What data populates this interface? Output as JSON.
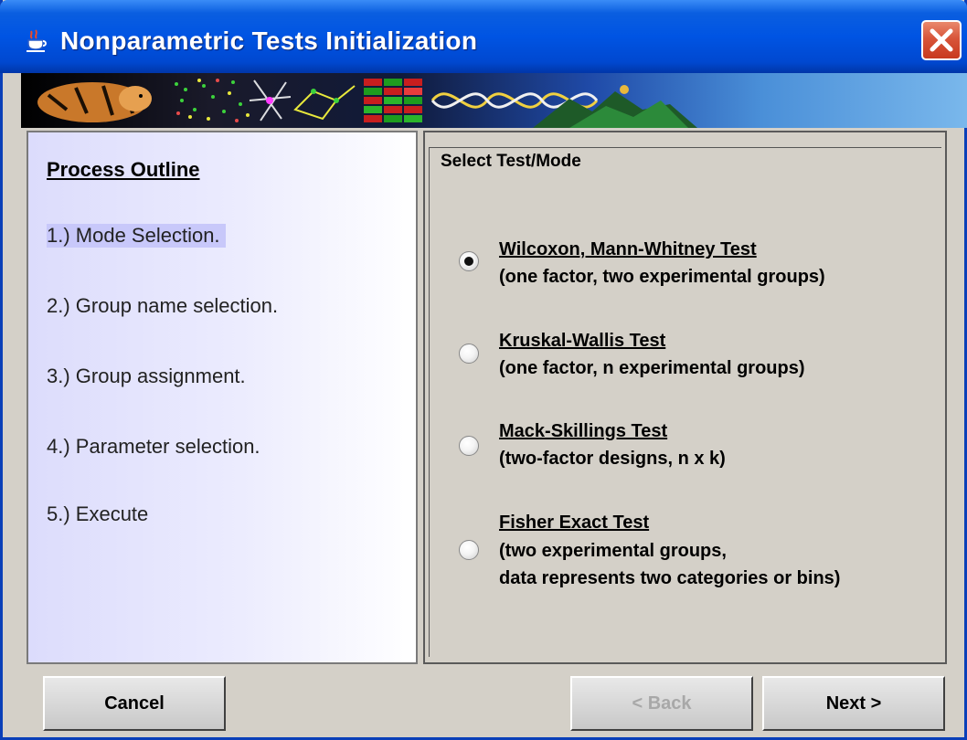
{
  "window": {
    "title": "Nonparametric Tests Initialization"
  },
  "outline": {
    "heading": "Process Outline",
    "steps": [
      "1.) Mode Selection.",
      "2.) Group name selection.",
      "3.) Group assignment.",
      "4.) Parameter selection.",
      "5.) Execute"
    ],
    "active_step": 0
  },
  "test_panel": {
    "label": "Select Test/Mode",
    "options": [
      {
        "title": "Wilcoxon, Mann-Whitney Test",
        "desc": [
          "(one factor, two experimental groups)"
        ],
        "selected": true
      },
      {
        "title": "Kruskal-Wallis Test",
        "desc": [
          "(one factor, n experimental groups)"
        ],
        "selected": false
      },
      {
        "title": "Mack-Skillings Test",
        "desc": [
          "(two-factor designs, n x k)"
        ],
        "selected": false
      },
      {
        "title": "Fisher Exact Test",
        "desc": [
          "(two experimental groups,",
          "data represents two categories or bins)"
        ],
        "selected": false
      }
    ]
  },
  "buttons": {
    "cancel": "Cancel",
    "back": "< Back",
    "next": "Next >",
    "back_enabled": false
  },
  "icons": {
    "title_icon": "java-cup-icon",
    "close_icon": "close-icon",
    "banner": "banner-image"
  },
  "colors": {
    "titlebar": "#0054e3",
    "close": "#d8553a",
    "panel_bg": "#d4d0c8",
    "outline_gradient_start": "#dcdcfc",
    "active_step_bg": "#c8c8fa"
  }
}
